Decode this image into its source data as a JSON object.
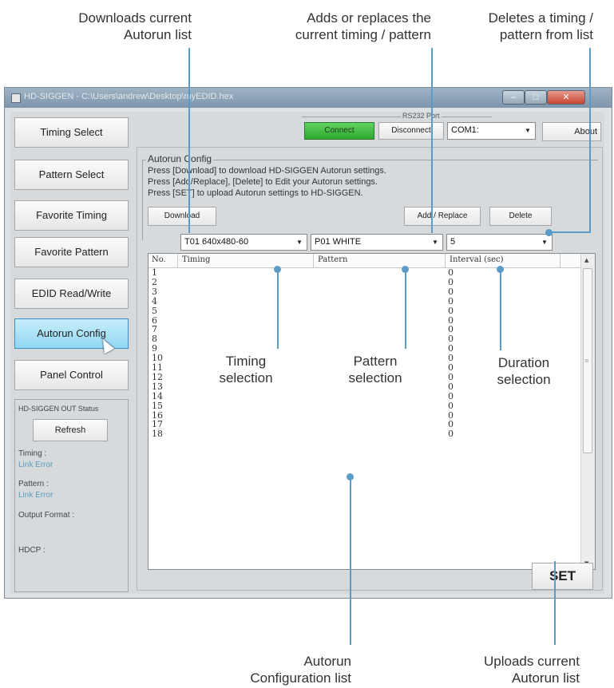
{
  "callouts": {
    "downloads": [
      "Downloads current",
      "Autorun list"
    ],
    "add_replace": [
      "Adds or replaces the",
      "current timing / pattern"
    ],
    "delete": [
      "Deletes a timing /",
      "pattern from list"
    ],
    "timing_selection": [
      "Timing",
      "selection"
    ],
    "pattern_selection": [
      "Pattern",
      "selection"
    ],
    "duration_selection": [
      "Duration",
      "selection"
    ],
    "autorun_list": [
      "Autorun",
      "Configuration list"
    ],
    "uploads": [
      "Uploads current",
      "Autorun list"
    ]
  },
  "window": {
    "title": "HD-SIGGEN - C:\\Users\\andrew\\Desktop\\myEDID.hex"
  },
  "nav": {
    "items": [
      {
        "label": "Timing Select"
      },
      {
        "label": "Pattern Select"
      },
      {
        "label": "Favorite Timing"
      },
      {
        "label": "Favorite Pattern"
      },
      {
        "label": "EDID Read/Write"
      },
      {
        "label": "Autorun Config"
      },
      {
        "label": "Panel Control"
      }
    ],
    "active_index": 5
  },
  "status": {
    "title": "HD-SIGGEN OUT Status",
    "refresh_label": "Refresh",
    "timing_label": "Timing :",
    "timing_value": "Link Error",
    "pattern_label": "Pattern :",
    "pattern_value": "Link Error",
    "output_format_label": "Output Format :",
    "hdcp_label": "HDCP :"
  },
  "rs232": {
    "group_label": "RS232 Port",
    "connect_label": "Connect",
    "disconnect_label": "Disconnect",
    "port_value": "COM1:",
    "about_label": "About"
  },
  "autorun": {
    "group_label": "Autorun Config",
    "instructions": [
      "Press [Download] to download HD-SIGGEN Autorun settings.",
      "Press [Add/Replace], [Delete] to Edit your Autorun settings.",
      "Press [SET] to upload Autorun settings to HD-SIGGEN."
    ],
    "download_label": "Download",
    "add_replace_label": "Add / Replace",
    "delete_label": "Delete",
    "timing_value": "T01 640x480-60",
    "pattern_value": "P01 WHITE",
    "interval_value": "5",
    "columns": [
      "No.",
      "Timing",
      "Pattern",
      "Interval (sec)"
    ],
    "rows": [
      {
        "no": "1",
        "interval": "0"
      },
      {
        "no": "2",
        "interval": "0"
      },
      {
        "no": "3",
        "interval": "0"
      },
      {
        "no": "4",
        "interval": "0"
      },
      {
        "no": "5",
        "interval": "0"
      },
      {
        "no": "6",
        "interval": "0"
      },
      {
        "no": "7",
        "interval": "0"
      },
      {
        "no": "8",
        "interval": "0"
      },
      {
        "no": "9",
        "interval": "0"
      },
      {
        "no": "10",
        "interval": "0"
      },
      {
        "no": "11",
        "interval": "0"
      },
      {
        "no": "12",
        "interval": "0"
      },
      {
        "no": "13",
        "interval": "0"
      },
      {
        "no": "14",
        "interval": "0"
      },
      {
        "no": "15",
        "interval": "0"
      },
      {
        "no": "16",
        "interval": "0"
      },
      {
        "no": "17",
        "interval": "0"
      },
      {
        "no": "18",
        "interval": "0"
      }
    ],
    "set_label": "SET"
  },
  "colors": {
    "accent": "#5b9bc8",
    "connect_green": "#3fbf3f",
    "active_nav": "#9fdcf4",
    "link_error": "#5c9cb8"
  }
}
